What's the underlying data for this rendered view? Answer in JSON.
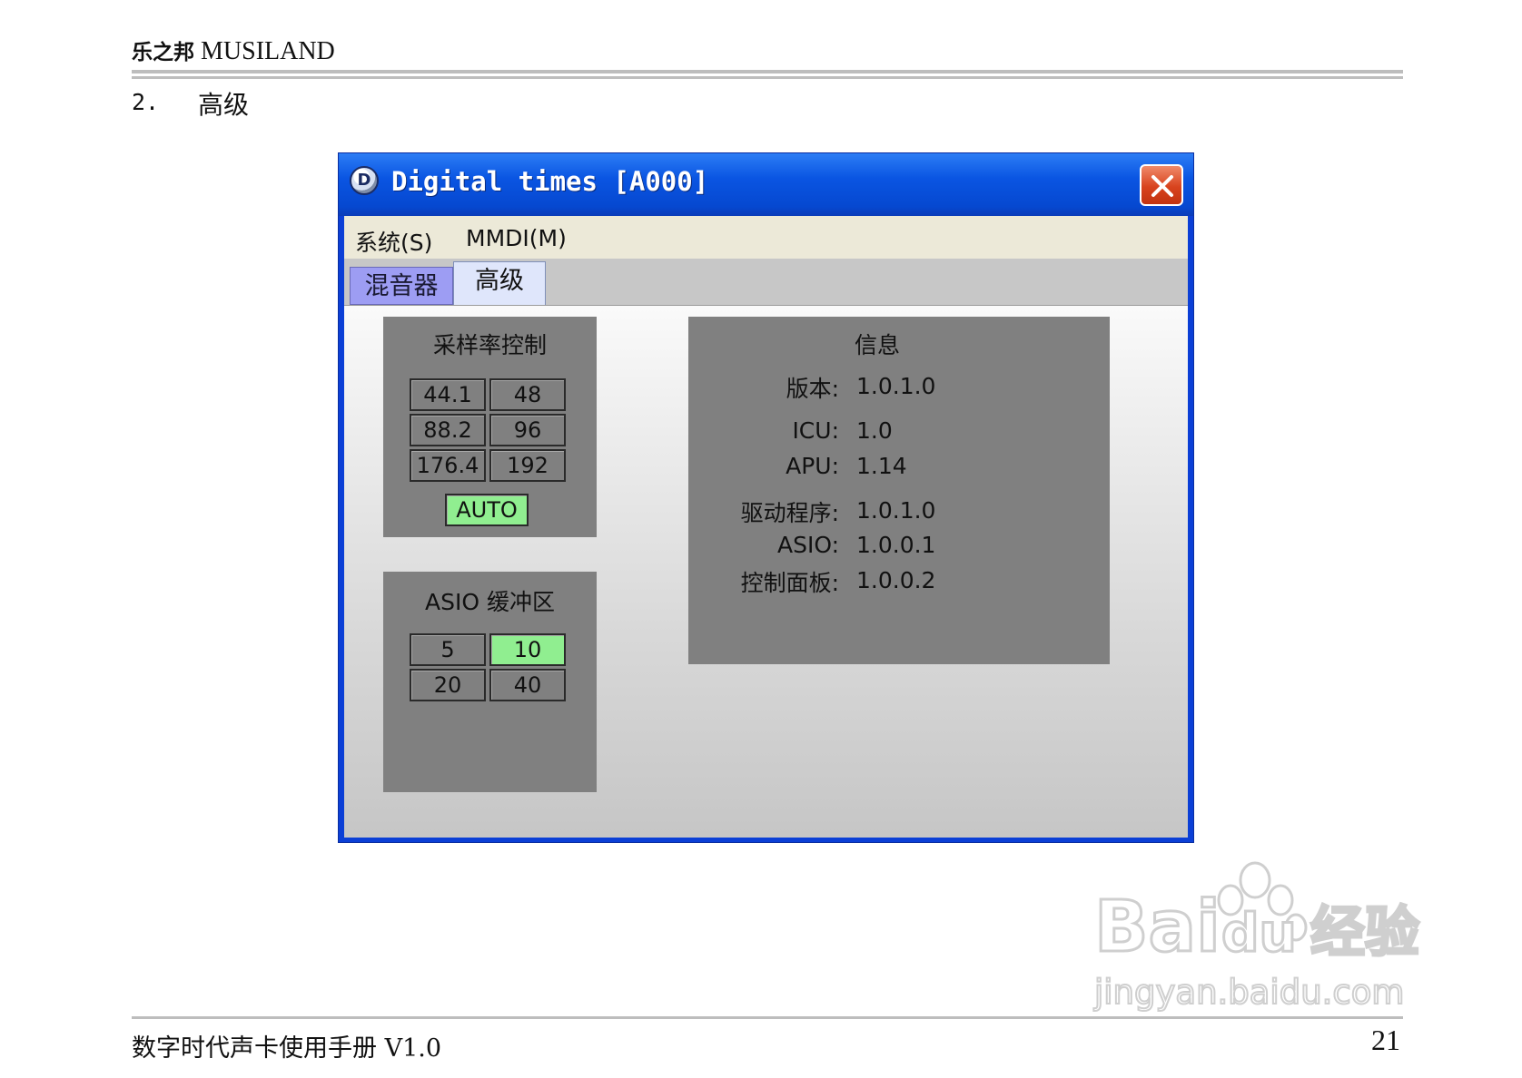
{
  "header": {
    "brand_cn": "乐之邦",
    "brand_en": "MUSILAND",
    "section_number": "2.",
    "section_title": "高级"
  },
  "window": {
    "title": "Digital times [A000]",
    "app_icon": "D",
    "menu": [
      "系统(S)",
      "MMDI(M)"
    ],
    "tabs": [
      {
        "label": "混音器",
        "selected": false
      },
      {
        "label": "高级",
        "selected": true
      }
    ],
    "sample_rate": {
      "title": "采样率控制",
      "buttons": [
        "44.1",
        "48",
        "88.2",
        "96",
        "176.4",
        "192"
      ],
      "auto_label": "AUTO",
      "selected": "AUTO"
    },
    "asio_buffer": {
      "title": "ASIO 缓冲区",
      "buttons": [
        "5",
        "10",
        "20",
        "40"
      ],
      "selected": "10"
    },
    "info": {
      "title": "信息",
      "rows": [
        {
          "label": "版本:",
          "value": "1.0.1.0"
        },
        {
          "label": "ICU:",
          "value": "1.0"
        },
        {
          "label": "APU:",
          "value": "1.14"
        },
        {
          "label": "驱动程序:",
          "value": "1.0.1.0"
        },
        {
          "label": "ASIO:",
          "value": "1.0.0.1"
        },
        {
          "label": "控制面板:",
          "value": "1.0.0.2"
        }
      ]
    }
  },
  "footer": {
    "text": "数字时代声卡使用手册 V1.0",
    "page_number": "21"
  },
  "watermark": {
    "logo_text": "Bai du 经验",
    "url": "jingyan.baidu.com"
  },
  "colors": {
    "titlebar": "#0a55e2",
    "active_button": "#90ee90",
    "panel": "#808080",
    "mixer_tab": "#9d9df3",
    "close_button": "#d8431e"
  }
}
